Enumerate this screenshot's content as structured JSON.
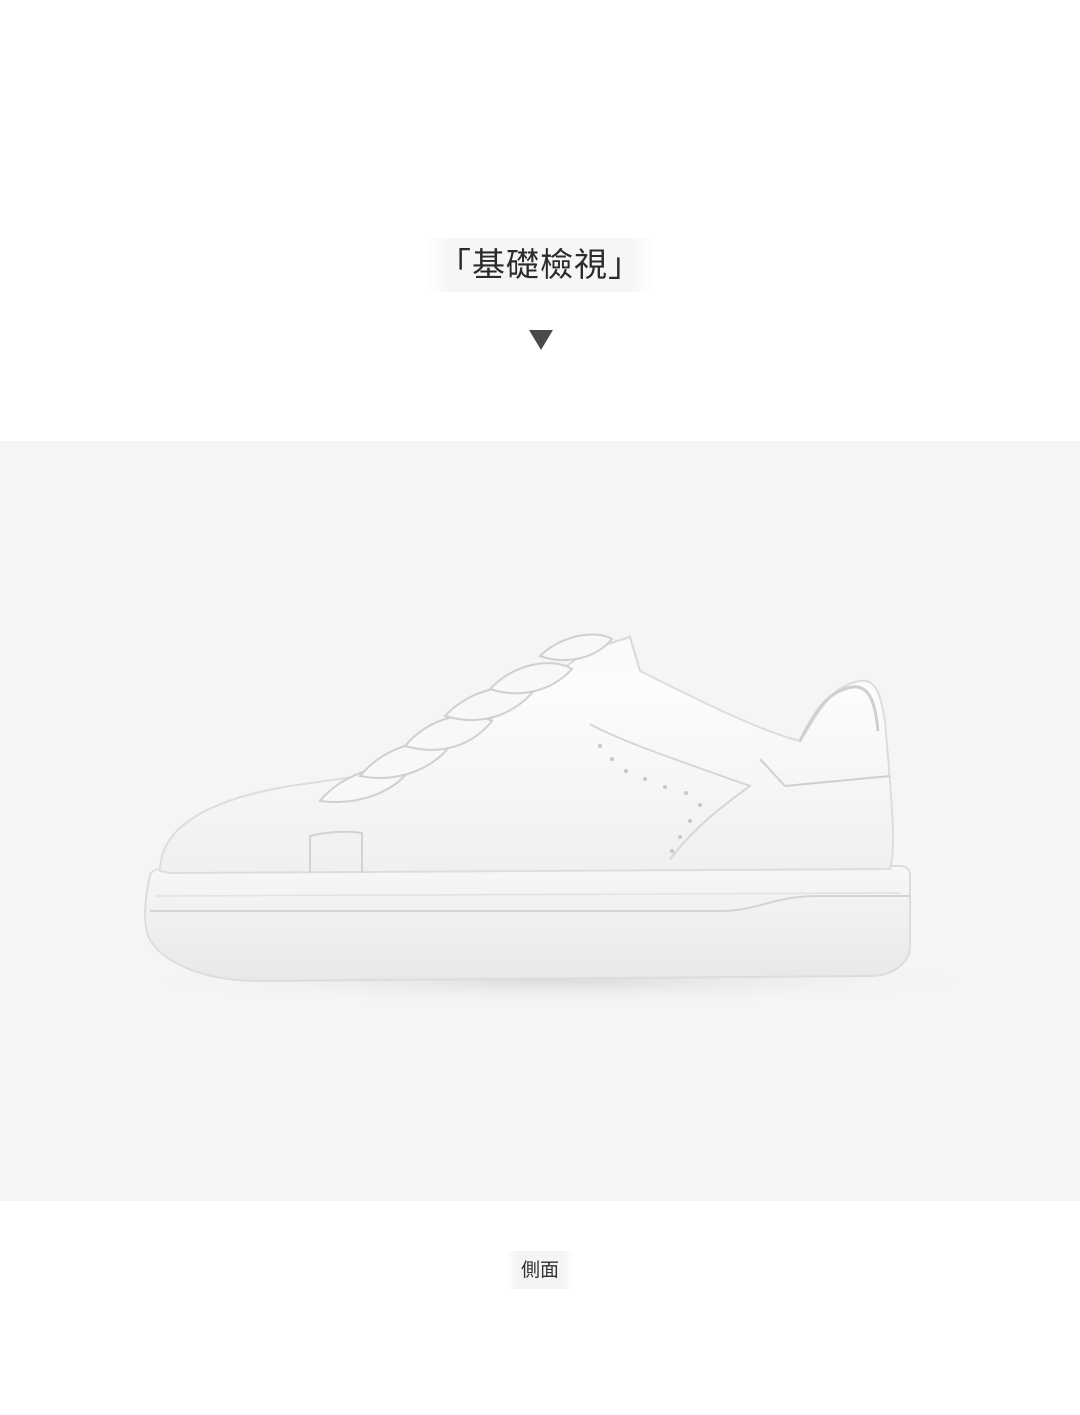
{
  "section": {
    "title": "「基礎檢視」",
    "arrow_icon": "triangle-down-icon"
  },
  "product_photo": {
    "subject": "sneaker-image",
    "background_color": "#f5f5f5"
  },
  "caption": {
    "label": "側面"
  },
  "colors": {
    "page_background": "#ffffff",
    "arrow": "#4a4a4a",
    "title_text": "#2b2b2b"
  }
}
